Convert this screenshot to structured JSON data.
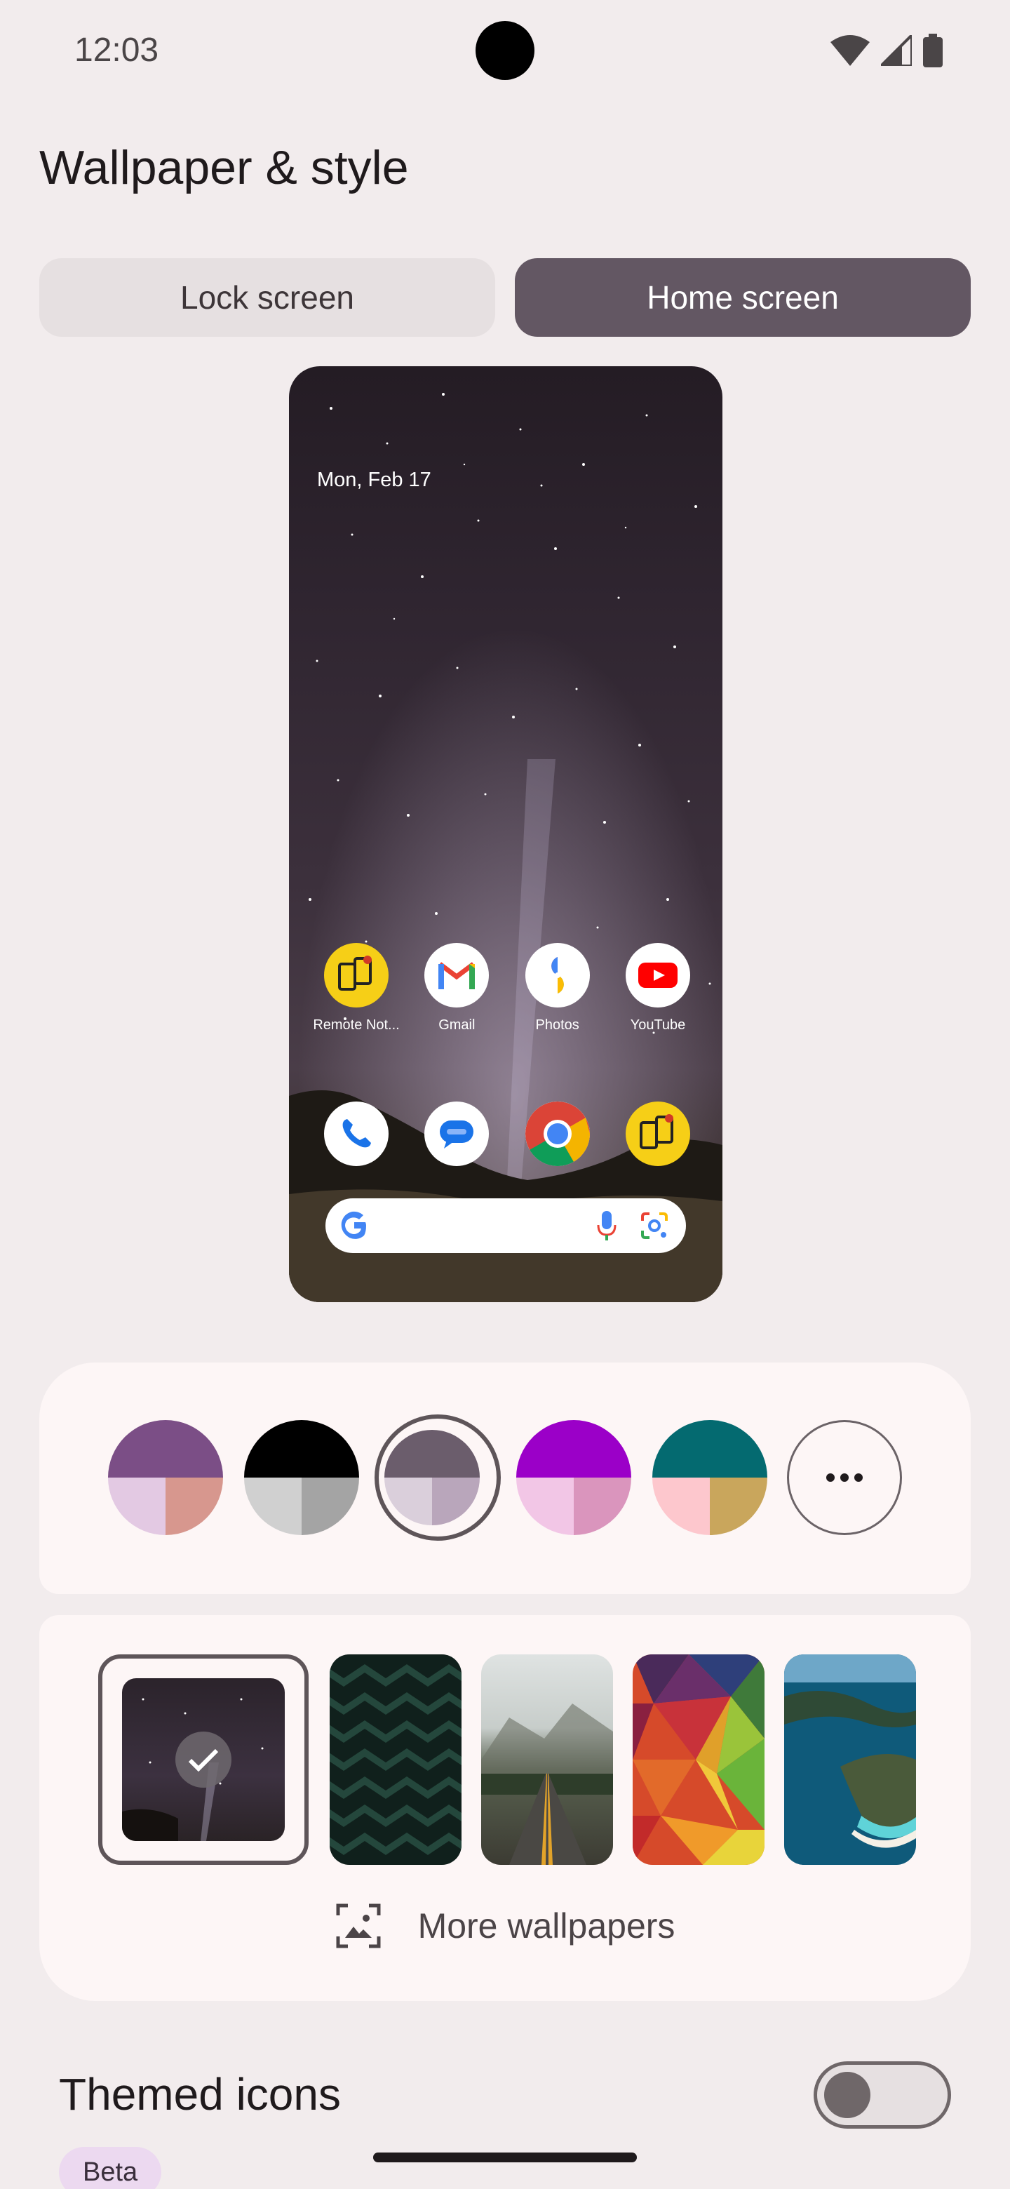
{
  "status_bar": {
    "time": "12:03",
    "icons": [
      "wifi-icon",
      "signal-icon",
      "battery-icon"
    ]
  },
  "page_title": "Wallpaper & style",
  "tabs": [
    {
      "label": "Lock screen",
      "selected": false
    },
    {
      "label": "Home screen",
      "selected": true
    }
  ],
  "preview": {
    "date": "Mon, Feb 17",
    "apps_row1": [
      {
        "label": "Remote Not...",
        "icon": "remote-notify-icon"
      },
      {
        "label": "Gmail",
        "icon": "gmail-icon"
      },
      {
        "label": "Photos",
        "icon": "photos-icon"
      },
      {
        "label": "YouTube",
        "icon": "youtube-icon"
      }
    ],
    "apps_row2": [
      {
        "icon": "phone-icon"
      },
      {
        "icon": "messages-icon"
      },
      {
        "icon": "chrome-icon"
      },
      {
        "icon": "remote-notify-icon"
      }
    ],
    "search_bar_icons": [
      "google-icon",
      "mic-icon",
      "lens-icon"
    ]
  },
  "color_options": [
    {
      "top": "#7b4e86",
      "bl": "#e3c9e3",
      "br": "#d7978e",
      "selected": false
    },
    {
      "top": "#000000",
      "bl": "#d0d0d0",
      "br": "#a4a4a4",
      "selected": false
    },
    {
      "top": "#6b5d6c",
      "bl": "#dacfdb",
      "br": "#b9a6bb",
      "selected": true
    },
    {
      "top": "#9b00c8",
      "bl": "#f2c6e6",
      "br": "#da95bd",
      "selected": false
    },
    {
      "top": "#046a70",
      "bl": "#fdc7cd",
      "br": "#c9a65c",
      "selected": false
    }
  ],
  "more_wallpapers_label": "More wallpapers",
  "themed_icons": {
    "label": "Themed icons",
    "enabled": false,
    "badge": "Beta"
  }
}
